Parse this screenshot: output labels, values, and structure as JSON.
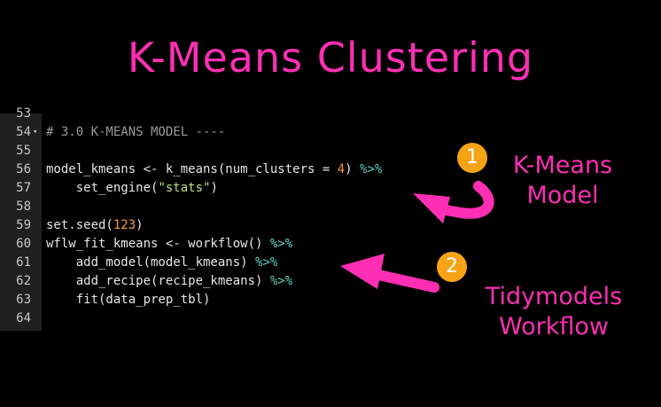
{
  "title": "K-Means Clustering",
  "colors": {
    "background": "#000000",
    "accent_pink": "#ff2fb4",
    "badge_orange": "#f6a316",
    "gutter": "#1f1f1f",
    "comment": "#9a9a9a",
    "number": "#f29a4a",
    "string": "#b8e08e",
    "pipe_operator": "#5fd3c4"
  },
  "editor": {
    "lines": [
      {
        "num": "53",
        "tokens": []
      },
      {
        "num": "54",
        "fold": "▾",
        "tokens": [
          {
            "t": "# 3.0 K-MEANS MODEL ----",
            "c": "cm"
          }
        ]
      },
      {
        "num": "55",
        "tokens": []
      },
      {
        "num": "56",
        "tokens": [
          {
            "t": "model_kmeans <- k_means(num_clusters = "
          },
          {
            "t": "4",
            "c": "num"
          },
          {
            "t": ") "
          },
          {
            "t": "%>%",
            "c": "pipe"
          }
        ]
      },
      {
        "num": "57",
        "tokens": [
          {
            "t": "    set_engine("
          },
          {
            "t": "\"stats\"",
            "c": "str"
          },
          {
            "t": ")"
          }
        ]
      },
      {
        "num": "58",
        "tokens": []
      },
      {
        "num": "59",
        "tokens": [
          {
            "t": "set.seed("
          },
          {
            "t": "123",
            "c": "num"
          },
          {
            "t": ")"
          }
        ]
      },
      {
        "num": "60",
        "tokens": [
          {
            "t": "wflw_fit_kmeans <- workflow() "
          },
          {
            "t": "%>%",
            "c": "pipe"
          }
        ]
      },
      {
        "num": "61",
        "tokens": [
          {
            "t": "    add_model(model_kmeans) "
          },
          {
            "t": "%>%",
            "c": "pipe"
          }
        ]
      },
      {
        "num": "62",
        "tokens": [
          {
            "t": "    add_recipe(recipe_kmeans) "
          },
          {
            "t": "%>%",
            "c": "pipe"
          }
        ]
      },
      {
        "num": "63",
        "tokens": [
          {
            "t": "    fit(data_prep_tbl)"
          }
        ]
      },
      {
        "num": "64",
        "tokens": []
      }
    ]
  },
  "annotations": [
    {
      "badge": "1",
      "lines": [
        "K-Means",
        "Model"
      ]
    },
    {
      "badge": "2",
      "lines": [
        "Tidymodels",
        "Workflow"
      ]
    }
  ]
}
